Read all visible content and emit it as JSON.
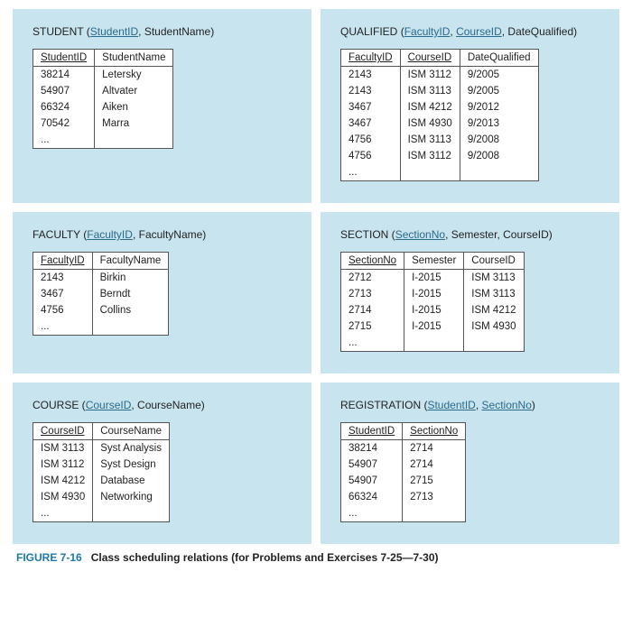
{
  "caption": {
    "figure": "FIGURE 7-16",
    "text": "Class scheduling relations (for Problems and Exercises 7-25—7-30)"
  },
  "relations": [
    {
      "name": "STUDENT",
      "keys": [
        "StudentID"
      ],
      "attrs": [
        "StudentID",
        "StudentName"
      ],
      "rows": [
        [
          "38214",
          "Letersky"
        ],
        [
          "54907",
          "Altvater"
        ],
        [
          "66324",
          "Aiken"
        ],
        [
          "70542",
          "Marra"
        ],
        [
          "...",
          ""
        ]
      ]
    },
    {
      "name": "QUALIFIED",
      "keys": [
        "FacultyID",
        "CourseID"
      ],
      "attrs": [
        "FacultyID",
        "CourseID",
        "DateQualified"
      ],
      "rows": [
        [
          "2143",
          "ISM 3112",
          "9/2005"
        ],
        [
          "2143",
          "ISM 3113",
          "9/2005"
        ],
        [
          "3467",
          "ISM 4212",
          "9/2012"
        ],
        [
          "3467",
          "ISM 4930",
          "9/2013"
        ],
        [
          "4756",
          "ISM 3113",
          "9/2008"
        ],
        [
          "4756",
          "ISM 3112",
          "9/2008"
        ],
        [
          "...",
          "",
          ""
        ]
      ]
    },
    {
      "name": "FACULTY",
      "keys": [
        "FacultyID"
      ],
      "attrs": [
        "FacultyID",
        "FacultyName"
      ],
      "rows": [
        [
          "2143",
          "Birkin"
        ],
        [
          "3467",
          "Berndt"
        ],
        [
          "4756",
          "Collins"
        ],
        [
          "...",
          ""
        ]
      ]
    },
    {
      "name": "SECTION",
      "keys": [
        "SectionNo"
      ],
      "attrs": [
        "SectionNo",
        "Semester",
        "CourseID"
      ],
      "rows": [
        [
          "2712",
          "I-2015",
          "ISM 3113"
        ],
        [
          "2713",
          "I-2015",
          "ISM 3113"
        ],
        [
          "2714",
          "I-2015",
          "ISM 4212"
        ],
        [
          "2715",
          "I-2015",
          "ISM 4930"
        ],
        [
          "...",
          "",
          ""
        ]
      ]
    },
    {
      "name": "COURSE",
      "keys": [
        "CourseID"
      ],
      "attrs": [
        "CourseID",
        "CourseName"
      ],
      "rows": [
        [
          "ISM 3113",
          "Syst Analysis"
        ],
        [
          "ISM 3112",
          "Syst Design"
        ],
        [
          "ISM 4212",
          "Database"
        ],
        [
          "ISM 4930",
          "Networking"
        ],
        [
          "...",
          ""
        ]
      ]
    },
    {
      "name": "REGISTRATION",
      "keys": [
        "StudentID",
        "SectionNo"
      ],
      "attrs": [
        "StudentID",
        "SectionNo"
      ],
      "rows": [
        [
          "38214",
          "2714"
        ],
        [
          "54907",
          "2714"
        ],
        [
          "54907",
          "2715"
        ],
        [
          "66324",
          "2713"
        ],
        [
          "...",
          ""
        ]
      ]
    }
  ]
}
